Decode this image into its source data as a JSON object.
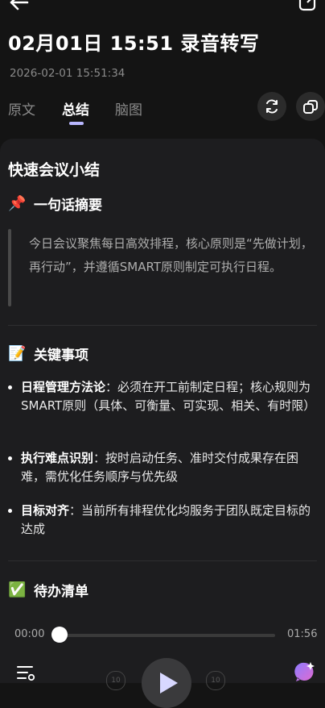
{
  "header": {
    "title": "02月01日 15:51 录音转写",
    "timestamp": "2026-02-01 15:51:34"
  },
  "tabs": [
    {
      "label": "原文"
    },
    {
      "label": "总结"
    },
    {
      "label": "脑图"
    }
  ],
  "summary": {
    "card_title": "快速会议小结",
    "one_line": {
      "heading": "一句话摘要",
      "emoji": "📌",
      "text": "今日会议聚焦每日高效排程，核心原则是“先做计划，再行动”，并遵循SMART原则制定可执行日程。"
    },
    "key_items": {
      "heading": "关键事项",
      "emoji": "📝",
      "items": [
        {
          "term": "日程管理方法论",
          "text": "：必须在开工前制定日程；核心规则为SMART原则（具体、可衡量、可实现、相关、有时限）"
        },
        {
          "term": "执行难点识别",
          "text": "：按时启动任务、准时交付成果存在困难，需优化任务顺序与优先级"
        },
        {
          "term": "目标对齐",
          "text": "：当前所有排程优化均服务于团队既定目标的达成"
        }
      ]
    },
    "todo": {
      "heading": "待办清单",
      "emoji": "✅"
    }
  },
  "player": {
    "current_time": "00:00",
    "total_time": "01:56",
    "progress": 0.0,
    "skip_back_label": "10",
    "skip_forward_label": "10"
  },
  "colors": {
    "background": "#141414",
    "card": "#1d1d1f",
    "accent": "#b9b7ff"
  },
  "icons": [
    "back-arrow-icon",
    "share-icon",
    "refresh-icon",
    "copy-icon",
    "settings-list-icon",
    "skip-back-icon",
    "play-icon",
    "skip-forward-icon",
    "ai-assistant-icon"
  ]
}
